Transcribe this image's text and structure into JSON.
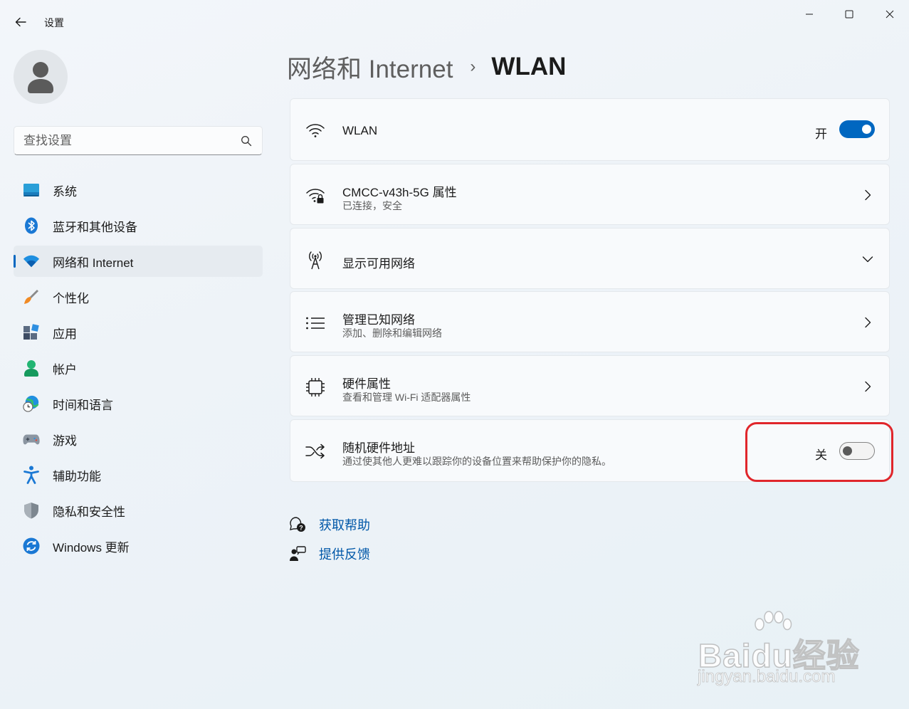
{
  "window": {
    "title": "设置",
    "back_icon": "arrow-left-icon",
    "controls": [
      "minimize",
      "maximize",
      "close"
    ]
  },
  "sidebar": {
    "search_placeholder": "查找设置",
    "items": [
      {
        "label": "系统",
        "icon": "system-display-icon",
        "active": false
      },
      {
        "label": "蓝牙和其他设备",
        "icon": "bluetooth-icon",
        "active": false
      },
      {
        "label": "网络和 Internet",
        "icon": "wifi-icon",
        "active": true
      },
      {
        "label": "个性化",
        "icon": "paintbrush-icon",
        "active": false
      },
      {
        "label": "应用",
        "icon": "apps-icon",
        "active": false
      },
      {
        "label": "帐户",
        "icon": "account-icon",
        "active": false
      },
      {
        "label": "时间和语言",
        "icon": "globe-clock-icon",
        "active": false
      },
      {
        "label": "游戏",
        "icon": "gamepad-icon",
        "active": false
      },
      {
        "label": "辅助功能",
        "icon": "accessibility-icon",
        "active": false
      },
      {
        "label": "隐私和安全性",
        "icon": "shield-icon",
        "active": false
      },
      {
        "label": "Windows 更新",
        "icon": "windows-update-icon",
        "active": false
      }
    ]
  },
  "breadcrumb": {
    "parent": "网络和 Internet",
    "separator": "›",
    "current": "WLAN"
  },
  "cards": {
    "wlan": {
      "title": "WLAN",
      "state": "开",
      "on": true
    },
    "properties": {
      "title": "CMCC-v43h-5G 属性",
      "subtitle": "已连接，安全"
    },
    "available": {
      "title": "显示可用网络"
    },
    "known": {
      "title": "管理已知网络",
      "subtitle": "添加、删除和编辑网络"
    },
    "hardware": {
      "title": "硬件属性",
      "subtitle": "查看和管理 Wi-Fi 适配器属性"
    },
    "random_mac": {
      "title": "随机硬件地址",
      "subtitle": "通过使其他人更难以跟踪你的设备位置来帮助保护你的隐私。",
      "state": "关",
      "on": false
    }
  },
  "help": {
    "get_help": "获取帮助",
    "feedback": "提供反馈"
  },
  "watermark": {
    "main": "Baidu经验",
    "sub": "jingyan.baidu.com"
  },
  "colors": {
    "accent": "#0067c0",
    "link": "#0057a8",
    "highlight": "#e0262b"
  }
}
